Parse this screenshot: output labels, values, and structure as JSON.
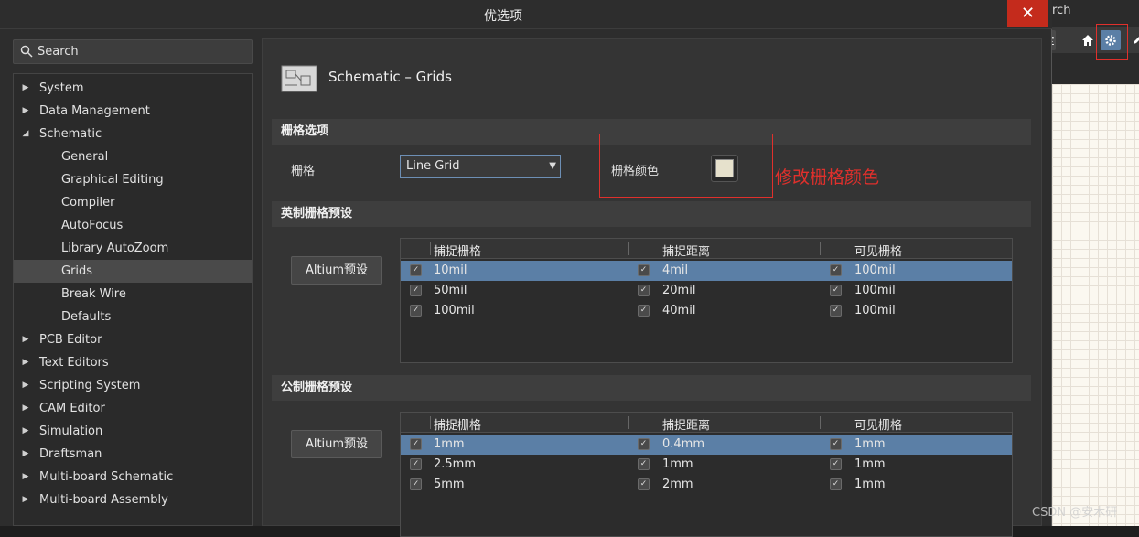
{
  "background_app": {
    "search_fragment": "rch",
    "home_icon": "home-icon",
    "gear_icon": "gear-icon",
    "partial_button_text": "定"
  },
  "dialog": {
    "title": "优选项",
    "close_glyph": "✕"
  },
  "search": {
    "placeholder": "Search"
  },
  "tree": [
    {
      "label": "System",
      "level": 0,
      "arrow": "▶"
    },
    {
      "label": "Data Management",
      "level": 0,
      "arrow": "▶"
    },
    {
      "label": "Schematic",
      "level": 0,
      "arrow": "◢"
    },
    {
      "label": "General",
      "level": 1,
      "arrow": ""
    },
    {
      "label": "Graphical Editing",
      "level": 1,
      "arrow": ""
    },
    {
      "label": "Compiler",
      "level": 1,
      "arrow": ""
    },
    {
      "label": "AutoFocus",
      "level": 1,
      "arrow": ""
    },
    {
      "label": "Library AutoZoom",
      "level": 1,
      "arrow": ""
    },
    {
      "label": "Grids",
      "level": 1,
      "arrow": "",
      "selected": true
    },
    {
      "label": "Break Wire",
      "level": 1,
      "arrow": ""
    },
    {
      "label": "Defaults",
      "level": 1,
      "arrow": ""
    },
    {
      "label": "PCB Editor",
      "level": 0,
      "arrow": "▶"
    },
    {
      "label": "Text Editors",
      "level": 0,
      "arrow": "▶"
    },
    {
      "label": "Scripting System",
      "level": 0,
      "arrow": "▶"
    },
    {
      "label": "CAM Editor",
      "level": 0,
      "arrow": "▶"
    },
    {
      "label": "Simulation",
      "level": 0,
      "arrow": "▶"
    },
    {
      "label": "Draftsman",
      "level": 0,
      "arrow": "▶"
    },
    {
      "label": "Multi-board Schematic",
      "level": 0,
      "arrow": "▶"
    },
    {
      "label": "Multi-board Assembly",
      "level": 0,
      "arrow": "▶"
    }
  ],
  "content": {
    "title": "Schematic – Grids",
    "grid_options": {
      "section_title": "栅格选项",
      "grid_label": "栅格",
      "grid_value": "Line Grid",
      "color_label": "栅格颜色",
      "color_value": "#e6e1cc",
      "annotation": "修改栅格颜色"
    },
    "imperial": {
      "section_title": "英制栅格预设",
      "preset_button": "Altium预设",
      "columns": [
        "捕捉栅格",
        "捕捉距离",
        "可见栅格"
      ],
      "rows": [
        {
          "snap": "10mil",
          "distance": "4mil",
          "visible": "100mil",
          "selected": true
        },
        {
          "snap": "50mil",
          "distance": "20mil",
          "visible": "100mil"
        },
        {
          "snap": "100mil",
          "distance": "40mil",
          "visible": "100mil"
        }
      ]
    },
    "metric": {
      "section_title": "公制栅格预设",
      "preset_button": "Altium预设",
      "columns": [
        "捕捉栅格",
        "捕捉距离",
        "可见栅格"
      ],
      "rows": [
        {
          "snap": "1mm",
          "distance": "0.4mm",
          "visible": "1mm",
          "selected": true
        },
        {
          "snap": "2.5mm",
          "distance": "1mm",
          "visible": "1mm"
        },
        {
          "snap": "5mm",
          "distance": "2mm",
          "visible": "1mm"
        }
      ]
    }
  },
  "watermark": "CSDN @安木研",
  "colors": {
    "accent": "#5b7fa6",
    "close": "#c42b1c",
    "annotation": "#e0302c"
  }
}
